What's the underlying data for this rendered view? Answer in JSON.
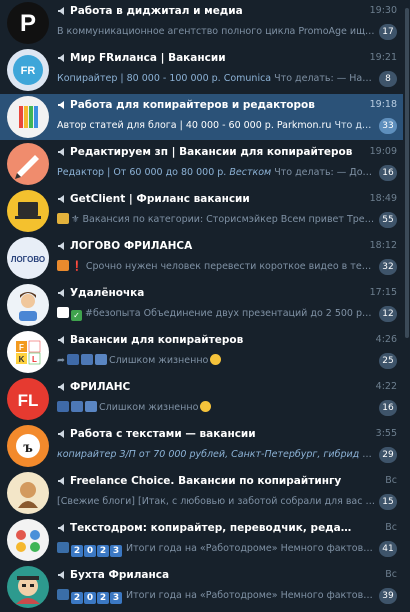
{
  "chats": [
    {
      "title": "Работа в диджитал и медиа",
      "time": "19:30",
      "preview": "В коммуникационное агентство полного цикла PromoAge ищут digit...",
      "badge": "17",
      "avatar": {
        "bg": "#111111",
        "text": "P"
      }
    },
    {
      "title": "Мир FRиланса | Вакансии",
      "time": "19:21",
      "preview_sender": "Копирайтер | 80 000 - 100 000 р. Comunica",
      "preview": "Что делать: — Написание м...",
      "badge": "8",
      "avatar": {
        "bg": "#dde6f2",
        "text": "FR"
      }
    },
    {
      "title": "Работа для копирайтеров и редакторов",
      "time": "19:18",
      "preview_sender": "Автор статей для блога | 40 000 - 60 000 р. Parkmon.ru",
      "preview": "Что делать: — ...",
      "badge": "33",
      "active": true,
      "avatar": {
        "bg": "#f2f2f2",
        "text": ""
      }
    },
    {
      "title": "Редактируем зп | Вакансии для копирайтеров",
      "time": "19:09",
      "preview_sender": "Редактор | От 60 000 до 80 000 р.",
      "preview_em": "Вестком",
      "preview": "Что делать: — Добавле...",
      "badge": "16",
      "avatar": {
        "bg": "#f08c6d",
        "text": ""
      }
    },
    {
      "title": "GetClient | Фриланс вакансии",
      "time": "18:49",
      "preview": "⚜ Вакансия по категории: Сторисмэйкер  Всем привет Требуетс...",
      "badge": "55",
      "avatar": {
        "bg": "#f4c12e",
        "text": ""
      }
    },
    {
      "title": "ЛОГОВО ФРИЛАНСА",
      "time": "18:12",
      "preview": "❗ Срочно нужен человек перевести короткое видео в текстовый ...",
      "badge": "32",
      "avatar": {
        "bg": "#e8eef7",
        "text": "ЛОГОВО"
      }
    },
    {
      "title": "Удалёночка",
      "time": "17:15",
      "preview": "#безопыта  Объединение двух презентаций  до 2 500 руб.",
      "badge": "12",
      "avatar": {
        "bg": "#eef3f8",
        "text": ""
      }
    },
    {
      "title": "Вакансии для копирайтеров",
      "time": "4:26",
      "preview": "Слишком жизненно",
      "badge": "25",
      "avatar": {
        "bg": "#ffffff",
        "text": "F K L"
      }
    },
    {
      "title": "ФРИЛАНС",
      "time": "4:22",
      "preview": "Слишком жизненно",
      "badge": "16",
      "avatar": {
        "bg": "#e63a30",
        "text": "FL"
      }
    },
    {
      "title": "Работа с текстами — вакансии",
      "time": "3:55",
      "preview_em": "копирайтер З/П от 70 000 рублей, Санкт-Петербург, гибрид",
      "preview": "«Счастл...",
      "badge": "29",
      "avatar": {
        "bg": "#f38a2c",
        "text": "ъ"
      }
    },
    {
      "title": "Freelance Choice. Вакансии по копирайтингу",
      "time": "Вс",
      "preview": "[Свежие блоги] [Итак, с любовью и заботой собрали для вас десяток ...",
      "badge": "15",
      "avatar": {
        "bg": "#f3e6c8",
        "text": ""
      }
    },
    {
      "title": "Текстодром: копирайтер, переводчик, редактор, журналист, смм...",
      "time": "Вс",
      "preview": "Итоги года на «Работодроме»  Немного фактов и ц...",
      "badge": "41",
      "avatar": {
        "bg": "#f3f3f3",
        "text": ""
      }
    },
    {
      "title": "Бухта Фриланса",
      "time": "Вс",
      "preview": "Итоги года на «Работодроме»  Немного фактов и ц...",
      "badge": "39",
      "avatar": {
        "bg": "#2d9a8e",
        "text": ""
      }
    }
  ],
  "year_tiles": [
    "2",
    "0",
    "2",
    "3"
  ],
  "colors": {
    "bg": "#17212b",
    "active": "#2b5278",
    "badge": "#3e546a",
    "badge_active": "#5e8fbd"
  }
}
